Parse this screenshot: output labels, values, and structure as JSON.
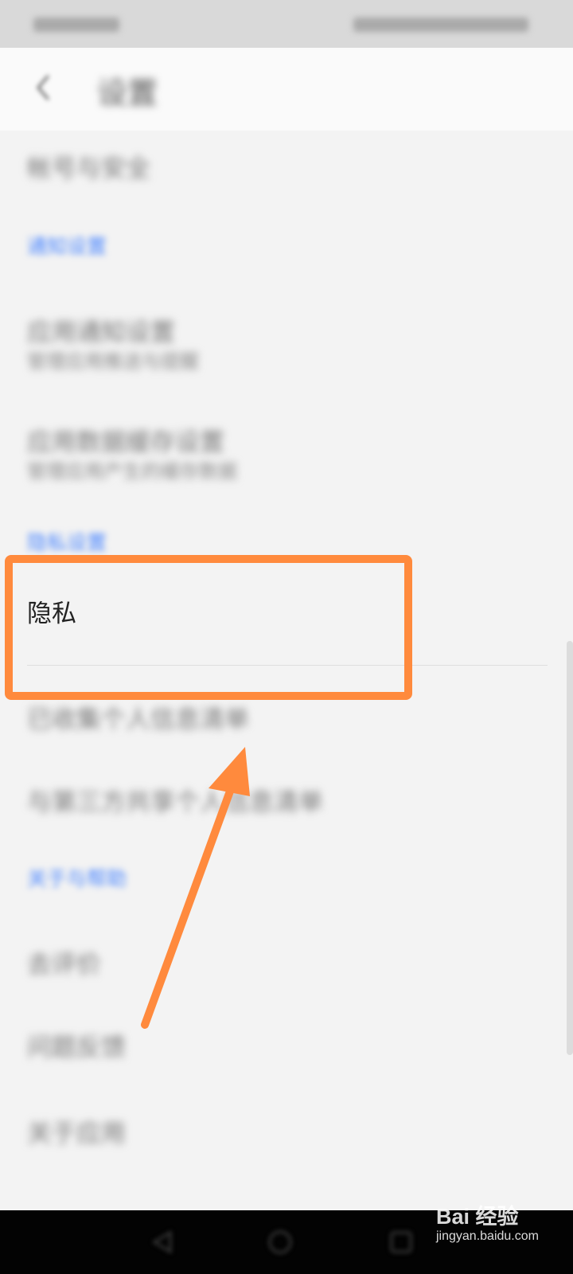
{
  "header": {
    "title": "设置",
    "back_icon": "chevron-left-icon"
  },
  "list": {
    "account_security": "帐号与安全",
    "section_personal": "通知设置",
    "app_notifications": "应用通知设置",
    "app_notifications_sub": "管理应用推送与提醒",
    "app_data": "应用数据缓存设置",
    "app_data_sub": "管理应用产生的缓存数据",
    "section_privacy": "隐私设置",
    "privacy": "隐私",
    "personal_info": "已收集个人信息清单",
    "third_party": "与第三方共享个人信息清单",
    "section_about": "关于与帮助",
    "rate": "去评价",
    "feedback": "问题反馈",
    "about": "关于应用"
  },
  "highlight": {
    "color": "#ff8a3d"
  },
  "watermark": {
    "main": "Bai 经验",
    "sub": "jingyan.baidu.com"
  },
  "nav_bar": {
    "icons": [
      "back-triangle-icon",
      "home-circle-icon",
      "recent-square-icon"
    ]
  },
  "colors": {
    "accent": "#4a86ff",
    "background": "#f3f3f3",
    "annotation": "#ff8a3d"
  }
}
